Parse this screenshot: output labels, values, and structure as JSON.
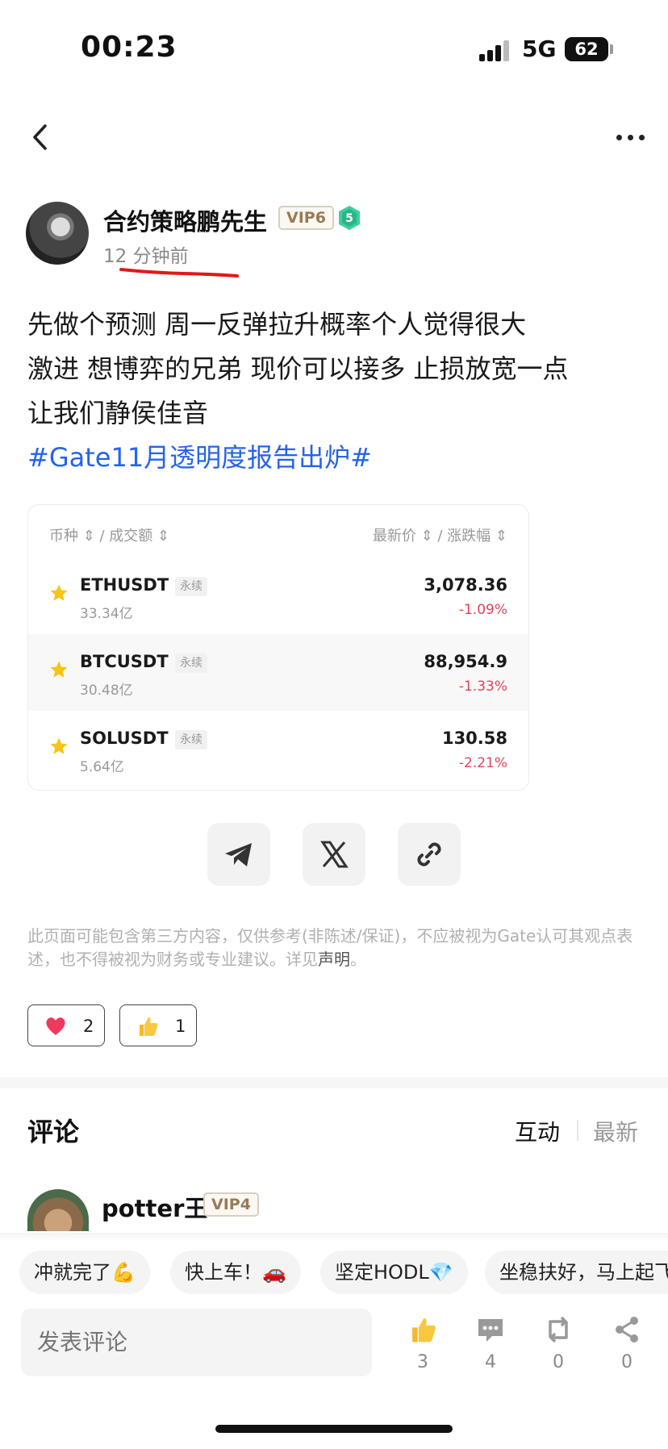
{
  "status_bar": {
    "time": "00:23",
    "network": "5G",
    "battery": "62"
  },
  "author": {
    "name": "合约策略鹏先生",
    "vip": "VIP6",
    "level": "5",
    "time_ago": "12 分钟前"
  },
  "post": {
    "lines": [
      "先做个预测  周一反弹拉升概率个人觉得很大",
      "激进 想博弈的兄弟 现价可以接多 止损放宽一点",
      "让我们静侯佳音"
    ],
    "hashtag": "#Gate11月透明度报告出炉#"
  },
  "market": {
    "header_left": "币种 ⇕ / 成交额 ⇕",
    "header_right": "最新价 ⇕ / 涨跌幅 ⇕",
    "rows": [
      {
        "symbol": "ETHUSDT",
        "tag": "永续",
        "volume": "33.34亿",
        "price": "3,078.36",
        "change": "-1.09%"
      },
      {
        "symbol": "BTCUSDT",
        "tag": "永续",
        "volume": "30.48亿",
        "price": "88,954.9",
        "change": "-1.33%"
      },
      {
        "symbol": "SOLUSDT",
        "tag": "永续",
        "volume": "5.64亿",
        "price": "130.58",
        "change": "-2.21%"
      }
    ]
  },
  "disclaimer": {
    "text": "此页面可能包含第三方内容，仅供参考(非陈述/保证)，不应被视为Gate认可其观点表述，也不得被视为财务或专业建议。详见",
    "link": "声明",
    "end": "。"
  },
  "reactions": {
    "heart": "2",
    "thumb": "1"
  },
  "comments": {
    "title": "评论",
    "tab_interact": "互动",
    "tab_latest": "最新",
    "first": {
      "name": "potter王",
      "vip": "VIP4"
    }
  },
  "quick_replies": [
    "冲就完了💪",
    "快上车！🚗",
    "坚定HODL💎",
    "坐稳扶好，马上起飞"
  ],
  "bottom_bar": {
    "placeholder": "发表评论",
    "likes": "3",
    "comments": "4",
    "reposts": "0",
    "shares": "0"
  },
  "colors": {
    "accent": "#2563eb",
    "negative": "#e0435a",
    "star": "#f5c518"
  }
}
